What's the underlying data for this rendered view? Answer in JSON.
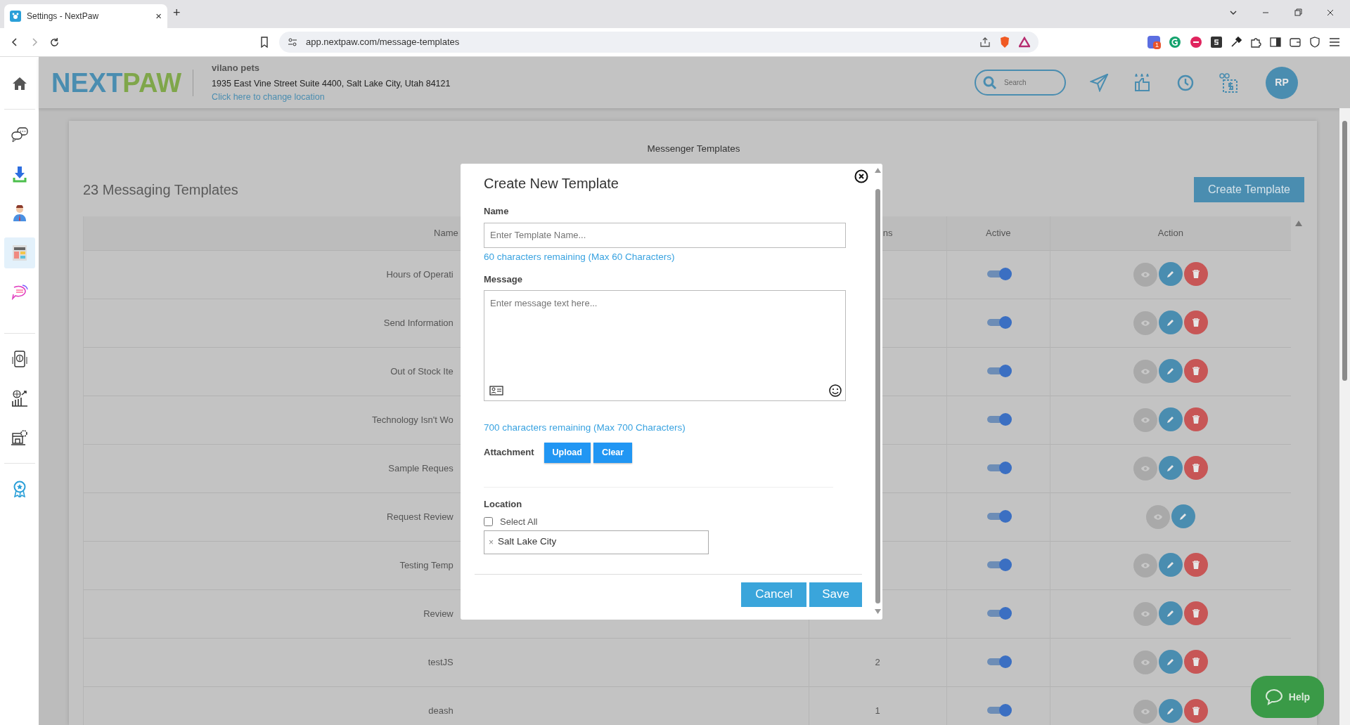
{
  "browser": {
    "tab_title": "Settings - NextPaw",
    "tab_close": "×",
    "new_tab": "+",
    "url": "app.nextpaw.com/message-templates",
    "extension_badge": "1"
  },
  "sidebar": {
    "items": [
      {
        "selected": false
      },
      {
        "selected": false
      },
      {
        "selected": false
      },
      {
        "selected": false
      },
      {
        "selected": true
      },
      {
        "selected": false
      },
      {
        "selected": false
      },
      {
        "selected": false
      },
      {
        "selected": false
      },
      {
        "selected": false
      }
    ]
  },
  "header": {
    "logo": [
      "NEXT",
      "PAW"
    ],
    "business": "vilano pets",
    "address": "1935 East Vine Street Suite 4400, Salt Lake City, Utah 84121",
    "change_location": "Click here to change location",
    "search_placeholder": "Search",
    "avatar": "RP"
  },
  "page": {
    "title": "Messenger Templates",
    "count_title": "23 Messaging Templates",
    "create_button": "Create Template"
  },
  "table": {
    "columns": [
      "Name",
      "ns",
      "Active",
      "Action"
    ],
    "rows": [
      {
        "name": "Hours of Operati",
        "active": true,
        "actions": [
          {
            "kind": "view"
          },
          {
            "kind": "edit"
          },
          {
            "kind": "delete"
          }
        ]
      },
      {
        "name": "Send Information",
        "active": true,
        "actions": [
          {
            "kind": "view"
          },
          {
            "kind": "edit"
          },
          {
            "kind": "delete"
          }
        ]
      },
      {
        "name": "Out of Stock Ite",
        "active": true,
        "actions": [
          {
            "kind": "view"
          },
          {
            "kind": "edit"
          },
          {
            "kind": "delete"
          }
        ]
      },
      {
        "name": "Technology Isn't Wo",
        "active": true,
        "actions": [
          {
            "kind": "view"
          },
          {
            "kind": "edit"
          },
          {
            "kind": "delete"
          }
        ]
      },
      {
        "name": "Sample Reques",
        "active": true,
        "actions": [
          {
            "kind": "view"
          },
          {
            "kind": "edit"
          },
          {
            "kind": "delete"
          }
        ]
      },
      {
        "name": "Request Review",
        "active": true,
        "actions": [
          {
            "kind": "view"
          },
          {
            "kind": "edit"
          }
        ]
      },
      {
        "name": "Testing Temp",
        "active": true,
        "actions": [
          {
            "kind": "view"
          },
          {
            "kind": "edit"
          },
          {
            "kind": "delete"
          }
        ]
      },
      {
        "name": "Review",
        "active": true,
        "actions": [
          {
            "kind": "view"
          },
          {
            "kind": "edit"
          },
          {
            "kind": "delete"
          }
        ]
      },
      {
        "name": "testJS",
        "column_2": "2",
        "active": true,
        "actions": [
          {
            "kind": "view"
          },
          {
            "kind": "edit"
          },
          {
            "kind": "delete"
          }
        ]
      },
      {
        "name": "deash",
        "column_2": "1",
        "active": true,
        "actions": [
          {
            "kind": "view"
          },
          {
            "kind": "edit"
          },
          {
            "kind": "delete"
          }
        ]
      }
    ]
  },
  "dialog": {
    "title": "Create New Template",
    "name_label": "Name",
    "name_placeholder": "Enter Template Name...",
    "name_counter": "60 characters remaining (Max 60 Characters)",
    "message_label": "Message",
    "message_placeholder": "Enter message text here...",
    "message_counter": "700 characters remaining (Max 700 Characters)",
    "attachment_label": "Attachment",
    "upload_button": "Upload",
    "clear_button": "Clear",
    "location_label": "Location",
    "select_all": {
      "label": "Select All",
      "checked": false
    },
    "locations": [
      {
        "remove": "×",
        "label": "Salt Lake City"
      }
    ],
    "cancel_button": "Cancel",
    "save_button": "Save"
  },
  "help_button": "Help"
}
